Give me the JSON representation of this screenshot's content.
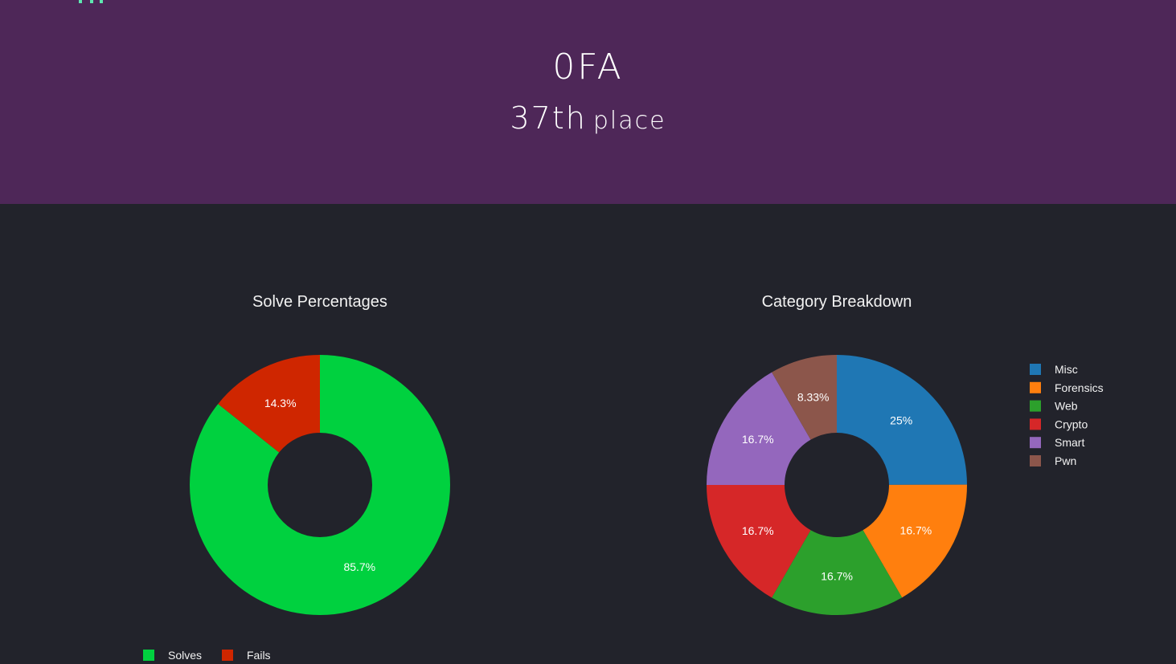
{
  "team": {
    "name": "0FA",
    "place_number": "37th",
    "place_word": "place"
  },
  "colors": {
    "header_bg": "#4e2758",
    "page_bg": "#22232b",
    "logo_accent": "#5ee6b0"
  },
  "chart_data": [
    {
      "type": "pie",
      "hole": true,
      "title": "Solve Percentages",
      "legend_position": "bottom",
      "labels": [
        "Solves",
        "Fails"
      ],
      "values": [
        85.7,
        14.3
      ],
      "data_labels": [
        "85.7%",
        "14.3%"
      ],
      "colors": [
        "#00d13f",
        "#cf2600"
      ]
    },
    {
      "type": "pie",
      "hole": true,
      "title": "Category Breakdown",
      "legend_position": "right",
      "labels": [
        "Misc",
        "Forensics",
        "Web",
        "Crypto",
        "Smart",
        "Pwn"
      ],
      "values": [
        25,
        16.7,
        16.7,
        16.7,
        16.7,
        8.33
      ],
      "data_labels": [
        "25%",
        "16.7%",
        "16.7%",
        "16.7%",
        "16.7%",
        "8.33%"
      ],
      "colors": [
        "#1f77b4",
        "#ff7f0e",
        "#2ca02c",
        "#d62728",
        "#9467bd",
        "#8c564b"
      ]
    }
  ]
}
